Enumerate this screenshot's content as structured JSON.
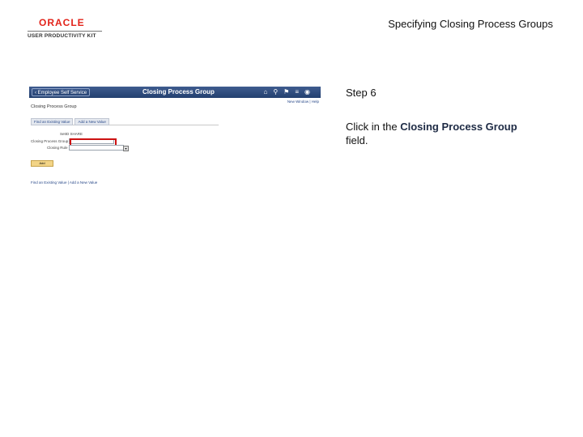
{
  "logo": {
    "brand": "ORACLE",
    "product": "USER PRODUCTIVITY KIT"
  },
  "document_title": "Specifying Closing Process Groups",
  "screenshot": {
    "back_button": "Employee Self Service",
    "page_heading": "Closing Process Group",
    "header_icons": [
      "home-icon",
      "search-icon",
      "flag-icon",
      "menu-icon",
      "compass-icon"
    ],
    "header_links": "New Window | Help",
    "title": "Closing Process Group",
    "tabs": [
      "Find an Existing Value",
      "Add a New Value"
    ],
    "fields": [
      {
        "label": "SetID",
        "value": "SHARE"
      },
      {
        "label": "Closing Process Group"
      },
      {
        "label": "Closing Rule"
      }
    ],
    "add_button": "Add",
    "footer_links": "Find an Existing Value | Add a New Value"
  },
  "step": {
    "label": "Step 6"
  },
  "instruction": {
    "prefix": "Click in the ",
    "target": "Closing Process Group",
    "suffix": " field."
  },
  "colors": {
    "highlight": "#cc1111",
    "header_bar": "#2f4c7f",
    "oracle_red": "#e2231a"
  }
}
